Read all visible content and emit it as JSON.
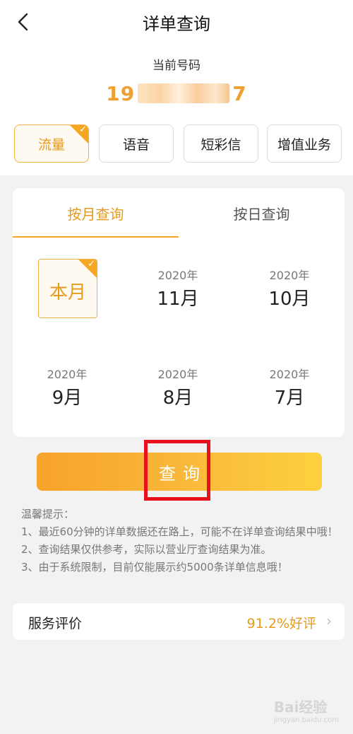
{
  "nav": {
    "title": "详单查询"
  },
  "account": {
    "label": "当前号码",
    "phone_prefix": "19",
    "phone_suffix": "7"
  },
  "service_tabs": [
    {
      "label": "流量",
      "active": true
    },
    {
      "label": "语音",
      "active": false
    },
    {
      "label": "短彩信",
      "active": false
    },
    {
      "label": "增值业务",
      "active": false
    }
  ],
  "query_tabs": [
    {
      "label": "按月查询",
      "active": true
    },
    {
      "label": "按日查询",
      "active": false
    }
  ],
  "months": [
    {
      "year": "",
      "month": "本月",
      "selected": true
    },
    {
      "year": "2020年",
      "month": "11月",
      "selected": false
    },
    {
      "year": "2020年",
      "month": "10月",
      "selected": false
    },
    {
      "year": "2020年",
      "month": "9月",
      "selected": false
    },
    {
      "year": "2020年",
      "month": "8月",
      "selected": false
    },
    {
      "year": "2020年",
      "month": "7月",
      "selected": false
    }
  ],
  "query_button": {
    "label": "查询"
  },
  "tips": {
    "title": "温馨提示：",
    "items": [
      "1、最近60分钟的详单数据还在路上，可能不在详单查询结果中哦！",
      "2、查询结果仅供参考，实际以营业厅查询结果为准。",
      "3、由于系统限制，目前仅能展示约5000条详单信息哦！"
    ]
  },
  "rating": {
    "label": "服务评价",
    "value": "91.2%好评"
  },
  "watermark": {
    "text": "Bai经验",
    "sub": "jingyan.baidu.com"
  },
  "colors": {
    "accent": "#f5a623",
    "highlight_box": "#e8101c"
  }
}
